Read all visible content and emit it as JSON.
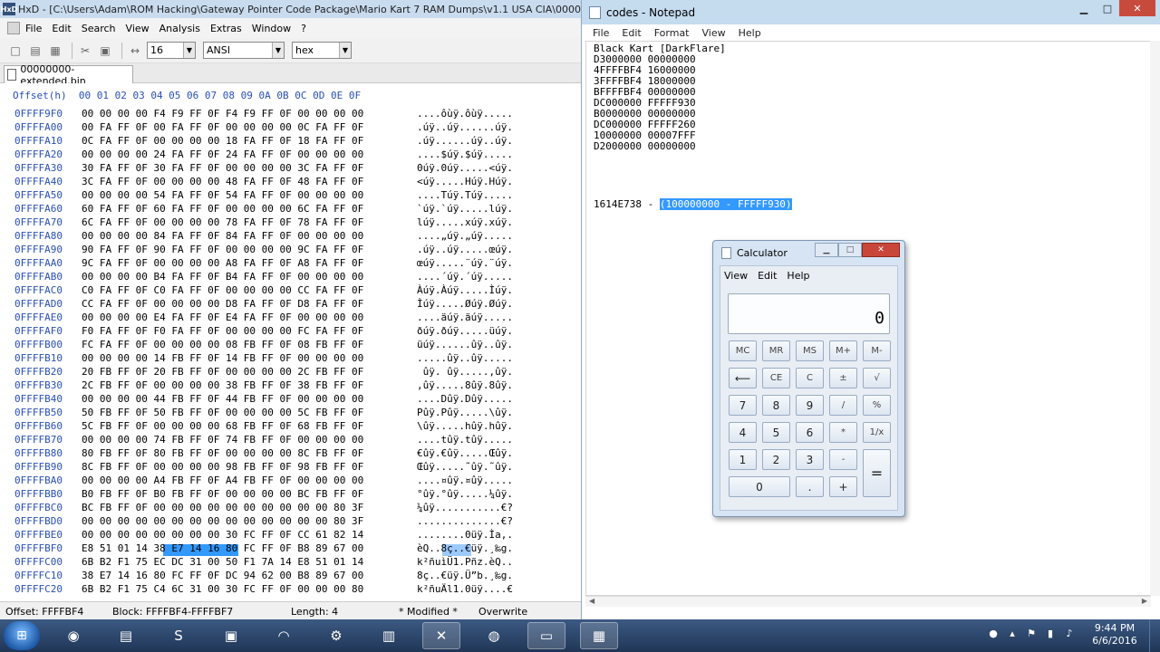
{
  "hxd": {
    "title": "HxD - [C:\\Users\\Adam\\ROM Hacking\\Gateway Pointer Code Package\\Mario Kart 7 RAM Dumps\\v1.1 USA CIA\\00000000-exte",
    "app_icon": "HxD",
    "menu": [
      "File",
      "Edit",
      "Search",
      "View",
      "Analysis",
      "Extras",
      "Window",
      "?"
    ],
    "toolbar": {
      "bytes_per_row": "16",
      "charset": "ANSI",
      "offset_base": "hex"
    },
    "tab_label": "00000000-extended.bin",
    "hex_header": "Offset(h)  00 01 02 03 04 05 06 07 08 09 0A 0B 0C 0D 0E 0F",
    "rows": [
      {
        "off": "0FFFF9F0",
        "bytes": "00 00 00 00 F4 F9 FF 0F F4 F9 FF 0F 00 00 00 00",
        "ascii": "....ôùÿ.ôùÿ....."
      },
      {
        "off": "0FFFFA00",
        "bytes": "00 FA FF 0F 00 FA FF 0F 00 00 00 00 0C FA FF 0F",
        "ascii": ".úÿ..úÿ......úÿ."
      },
      {
        "off": "0FFFFA10",
        "bytes": "0C FA FF 0F 00 00 00 00 18 FA FF 0F 18 FA FF 0F",
        "ascii": ".úÿ......úÿ..úÿ."
      },
      {
        "off": "0FFFFA20",
        "bytes": "00 00 00 00 24 FA FF 0F 24 FA FF 0F 00 00 00 00",
        "ascii": "....$úÿ.$úÿ....."
      },
      {
        "off": "0FFFFA30",
        "bytes": "30 FA FF 0F 30 FA FF 0F 00 00 00 00 3C FA FF 0F",
        "ascii": "0úÿ.0úÿ.....<úÿ."
      },
      {
        "off": "0FFFFA40",
        "bytes": "3C FA FF 0F 00 00 00 00 48 FA FF 0F 48 FA FF 0F",
        "ascii": "<úÿ.....Húÿ.Húÿ."
      },
      {
        "off": "0FFFFA50",
        "bytes": "00 00 00 00 54 FA FF 0F 54 FA FF 0F 00 00 00 00",
        "ascii": "....Túÿ.Túÿ....."
      },
      {
        "off": "0FFFFA60",
        "bytes": "60 FA FF 0F 60 FA FF 0F 00 00 00 00 6C FA FF 0F",
        "ascii": "`úÿ.`úÿ.....lúÿ."
      },
      {
        "off": "0FFFFA70",
        "bytes": "6C FA FF 0F 00 00 00 00 78 FA FF 0F 78 FA FF 0F",
        "ascii": "lúÿ.....xúÿ.xúÿ."
      },
      {
        "off": "0FFFFA80",
        "bytes": "00 00 00 00 84 FA FF 0F 84 FA FF 0F 00 00 00 00",
        "ascii": "....„úÿ.„úÿ....."
      },
      {
        "off": "0FFFFA90",
        "bytes": "90 FA FF 0F 90 FA FF 0F 00 00 00 00 9C FA FF 0F",
        "ascii": ".úÿ..úÿ.....œúÿ."
      },
      {
        "off": "0FFFFAA0",
        "bytes": "9C FA FF 0F 00 00 00 00 A8 FA FF 0F A8 FA FF 0F",
        "ascii": "œúÿ.....¨úÿ.¨úÿ."
      },
      {
        "off": "0FFFFAB0",
        "bytes": "00 00 00 00 B4 FA FF 0F B4 FA FF 0F 00 00 00 00",
        "ascii": "....´úÿ.´úÿ....."
      },
      {
        "off": "0FFFFAC0",
        "bytes": "C0 FA FF 0F C0 FA FF 0F 00 00 00 00 CC FA FF 0F",
        "ascii": "Àúÿ.Àúÿ.....Ìúÿ."
      },
      {
        "off": "0FFFFAD0",
        "bytes": "CC FA FF 0F 00 00 00 00 D8 FA FF 0F D8 FA FF 0F",
        "ascii": "Ìúÿ.....Øúÿ.Øúÿ."
      },
      {
        "off": "0FFFFAE0",
        "bytes": "00 00 00 00 E4 FA FF 0F E4 FA FF 0F 00 00 00 00",
        "ascii": "....äúÿ.äúÿ....."
      },
      {
        "off": "0FFFFAF0",
        "bytes": "F0 FA FF 0F F0 FA FF 0F 00 00 00 00 FC FA FF 0F",
        "ascii": "ðúÿ.ðúÿ.....üúÿ."
      },
      {
        "off": "0FFFFB00",
        "bytes": "FC FA FF 0F 00 00 00 00 08 FB FF 0F 08 FB FF 0F",
        "ascii": "üúÿ......ûÿ..ûÿ."
      },
      {
        "off": "0FFFFB10",
        "bytes": "00 00 00 00 14 FB FF 0F 14 FB FF 0F 00 00 00 00",
        "ascii": ".....ûÿ..ûÿ....."
      },
      {
        "off": "0FFFFB20",
        "bytes": "20 FB FF 0F 20 FB FF 0F 00 00 00 00 2C FB FF 0F",
        "ascii": " ûÿ. ûÿ.....,ûÿ."
      },
      {
        "off": "0FFFFB30",
        "bytes": "2C FB FF 0F 00 00 00 00 38 FB FF 0F 38 FB FF 0F",
        "ascii": ",ûÿ.....8ûÿ.8ûÿ."
      },
      {
        "off": "0FFFFB40",
        "bytes": "00 00 00 00 44 FB FF 0F 44 FB FF 0F 00 00 00 00",
        "ascii": "....Dûÿ.Dûÿ....."
      },
      {
        "off": "0FFFFB50",
        "bytes": "50 FB FF 0F 50 FB FF 0F 00 00 00 00 5C FB FF 0F",
        "ascii": "Pûÿ.Pûÿ.....\\ûÿ."
      },
      {
        "off": "0FFFFB60",
        "bytes": "5C FB FF 0F 00 00 00 00 68 FB FF 0F 68 FB FF 0F",
        "ascii": "\\ûÿ.....hûÿ.hûÿ."
      },
      {
        "off": "0FFFFB70",
        "bytes": "00 00 00 00 74 FB FF 0F 74 FB FF 0F 00 00 00 00",
        "ascii": "....tûÿ.tûÿ....."
      },
      {
        "off": "0FFFFB80",
        "bytes": "80 FB FF 0F 80 FB FF 0F 00 00 00 00 8C FB FF 0F",
        "ascii": "€ûÿ.€ûÿ.....Œûÿ."
      },
      {
        "off": "0FFFFB90",
        "bytes": "8C FB FF 0F 00 00 00 00 98 FB FF 0F 98 FB FF 0F",
        "ascii": "Œûÿ.....˜ûÿ.˜ûÿ."
      },
      {
        "off": "0FFFFBA0",
        "bytes": "00 00 00 00 A4 FB FF 0F A4 FB FF 0F 00 00 00 00",
        "ascii": "....¤ûÿ.¤ûÿ....."
      },
      {
        "off": "0FFFFBB0",
        "bytes": "B0 FB FF 0F B0 FB FF 0F 00 00 00 00 BC FB FF 0F",
        "ascii": "°ûÿ.°ûÿ.....¼ûÿ."
      },
      {
        "off": "0FFFFBC0",
        "bytes": "BC FB FF 0F 00 00 00 00 00 00 00 00 00 00 80 3F",
        "ascii": "¼ûÿ...........€?"
      },
      {
        "off": "0FFFFBD0",
        "bytes": "00 00 00 00 00 00 00 00 00 00 00 00 00 00 80 3F",
        "ascii": "..............€?"
      },
      {
        "off": "0FFFFBE0",
        "bytes": "00 00 00 00 00 00 00 00 30 FC FF 0F CC 61 82 14",
        "ascii": "........0üÿ.Ìa‚."
      },
      {
        "off": "0FFFFBF0",
        "bytes": "E8 51 01 14 38 E7 14 16 80 FC FF 0F B8 89 67 00",
        "ascii": "èQ..8ç..€üÿ.¸‰g."
      },
      {
        "off": "0FFFFC00",
        "bytes": "6B B2 F1 75 EC DC 31 00 50 F1 7A 14 E8 51 01 14",
        "ascii": "k²ñuìÜ1.Pñz.èQ.."
      },
      {
        "off": "0FFFFC10",
        "bytes": "38 E7 14 16 80 FC FF 0F DC 94 62 00 B8 89 67 00",
        "ascii": "8ç..€üÿ.Ü”b.¸‰g."
      },
      {
        "off": "0FFFFC20",
        "bytes": "6B B2 F1 75 C4 6C 31 00 30 FC FF 0F 00 00 00 80",
        "ascii": "k²ñuÄl1.0üÿ....€"
      }
    ],
    "status": {
      "offset": "Offset: FFFFBF4",
      "block": "Block: FFFFBF4-FFFFBF7",
      "length": "Length: 4",
      "modified": "* Modified *",
      "mode": "Overwrite"
    }
  },
  "notepad": {
    "title": "codes - Notepad",
    "menu": [
      "File",
      "Edit",
      "Format",
      "View",
      "Help"
    ],
    "lines": [
      "Black Kart [DarkFlare]",
      "D3000000 00000000",
      "4FFFFBF4 16000000",
      "3FFFFBF4 18000000",
      "BFFFFBF4 00000000",
      "DC000000 FFFFF930",
      "B0000000 00000000",
      "DC000000 FFFFF260",
      "10000000 00007FFF",
      "D2000000 00000000"
    ],
    "calc_line_prefix": "1614E738 - ",
    "calc_line_selected": "(100000000 - FFFFF930)"
  },
  "calculator": {
    "title": "Calculator",
    "menu": [
      "View",
      "Edit",
      "Help"
    ],
    "display": "0",
    "buttons": {
      "mc": "MC",
      "mr": "MR",
      "ms": "MS",
      "mplus": "M+",
      "mminus": "M-",
      "back": "⟵",
      "ce": "CE",
      "c": "C",
      "plusminus": "±",
      "sqrt": "√",
      "n7": "7",
      "n8": "8",
      "n9": "9",
      "div": "/",
      "pct": "%",
      "n4": "4",
      "n5": "5",
      "n6": "6",
      "mul": "*",
      "recip": "1/x",
      "n1": "1",
      "n2": "2",
      "n3": "3",
      "sub": "-",
      "eq": "=",
      "n0": "0",
      "dot": ".",
      "add": "+"
    }
  },
  "taskbar": {
    "time": "9:44 PM",
    "date": "6/6/2016",
    "apps": [
      "chrome-icon",
      "file-explorer-icon",
      "skype-icon",
      "generic-app-icon",
      "dolphin-icon",
      "steam-icon",
      "package-icon",
      "hxd-icon",
      "obs-icon",
      "notepad-icon",
      "calculator-icon"
    ]
  }
}
